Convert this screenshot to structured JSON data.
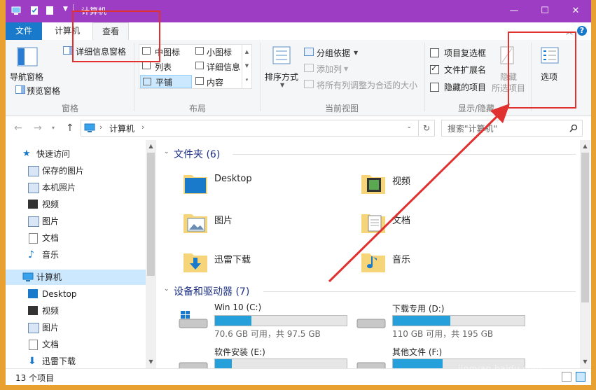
{
  "window": {
    "title": "计算机",
    "minimize": "—",
    "maximize": "☐",
    "close": "✕"
  },
  "tabs": {
    "file": "文件",
    "computer": "计算机",
    "view": "查看",
    "help": "?"
  },
  "ribbon": {
    "panes_group": {
      "label": "窗格",
      "nav_pane": "导航窗格",
      "preview_pane": "预览窗格",
      "details_pane": "详细信息窗格"
    },
    "layout_group": {
      "label": "布局",
      "items": [
        "中图标",
        "小图标",
        "列表",
        "详细信息",
        "平铺",
        "内容"
      ]
    },
    "current_view_group": {
      "label": "当前视图",
      "sort_by": "排序方式",
      "group_by": "分组依据",
      "add_column": "添加列",
      "fit_columns": "将所有列调整为合适的大小"
    },
    "show_hide_group": {
      "label": "显示/隐藏",
      "item_checkboxes": "项目复选框",
      "file_extensions": "文件扩展名",
      "hidden_items": "隐藏的项目",
      "hide_selected": "隐藏",
      "hide_selected_2": "所选项目"
    },
    "options": "选项"
  },
  "address": {
    "path": "计算机",
    "search_placeholder": "搜索\"计算机\""
  },
  "nav": {
    "quick_access": "快速访问",
    "items": [
      "保存的图片",
      "本机照片",
      "视频",
      "图片",
      "文档",
      "音乐"
    ],
    "computer": "计算机",
    "computer_items": [
      "Desktop",
      "视频",
      "图片",
      "文档",
      "迅雷下载"
    ]
  },
  "content": {
    "folders_header": "文件夹 (6)",
    "folders": [
      "Desktop",
      "视频",
      "图片",
      "文档",
      "迅雷下载",
      "音乐"
    ],
    "devices_header": "设备和驱动器 (7)",
    "drives": [
      {
        "name": "Win 10 (C:)",
        "info": "70.6 GB 可用，共 97.5 GB",
        "used": 0.276
      },
      {
        "name": "下载专用 (D:)",
        "info": "110 GB 可用，共 195 GB",
        "used": 0.436
      },
      {
        "name": "软件安装 (E:)",
        "info": "",
        "used": 0.13
      },
      {
        "name": "其他文件 (F:)",
        "info": "",
        "used": 0.38
      }
    ]
  },
  "status": {
    "count": "13 个项目"
  },
  "watermark": {
    "brand": "Bai经验",
    "url": "jingyan.baidu.com"
  },
  "colors": {
    "titlebar": "#9c3dc4",
    "accent": "#1979ca",
    "annotation": "#e03030"
  }
}
